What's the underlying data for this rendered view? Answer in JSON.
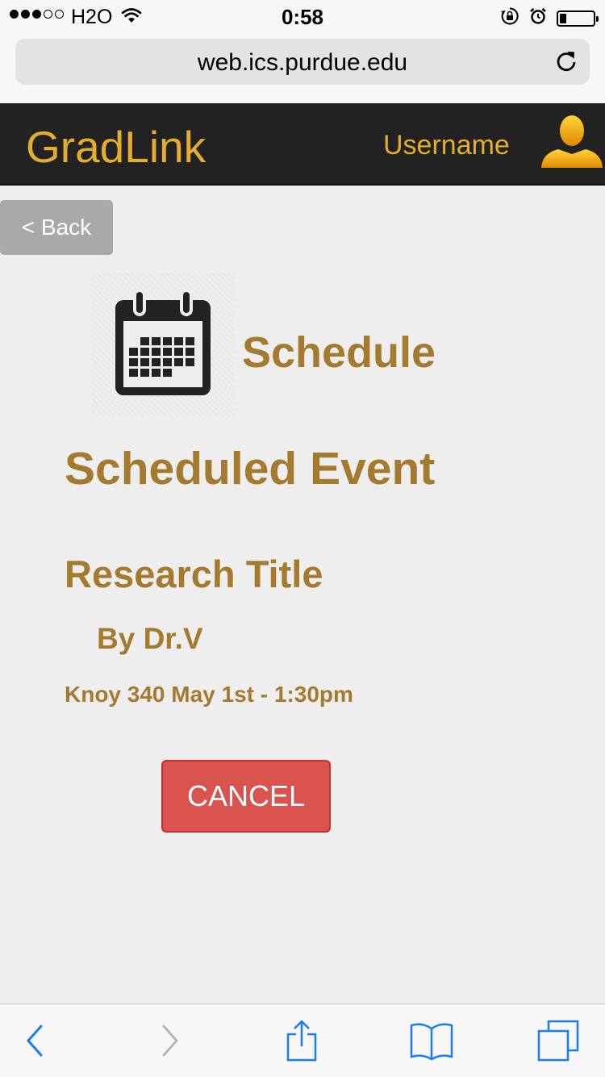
{
  "status_bar": {
    "carrier": "H2O",
    "time": "0:58",
    "signal_bars_filled": 3,
    "signal_bars_total": 5,
    "battery_level": 0.2,
    "icons": [
      "wifi-icon",
      "rotation-lock-icon",
      "alarm-icon",
      "battery-icon"
    ]
  },
  "browser": {
    "url": "web.ics.purdue.edu",
    "reload_icon": "reload-icon"
  },
  "header": {
    "brand": "GradLink",
    "username": "Username",
    "avatar_icon": "user-avatar-icon"
  },
  "nav": {
    "back_label": "< Back"
  },
  "main": {
    "section_icon": "calendar-icon",
    "section_title": "Schedule",
    "heading": "Scheduled Event",
    "event": {
      "title": "Research Title",
      "byline": "By Dr.V",
      "details": "Knoy 340 May 1st - 1:30pm"
    },
    "cancel_label": "CANCEL"
  },
  "toolbar": {
    "items": [
      "back-arrow-icon",
      "forward-arrow-icon",
      "share-icon",
      "bookmarks-icon",
      "tabs-icon"
    ]
  },
  "colors": {
    "accent": "#e4ad2b",
    "heading_text": "#a47a2f",
    "header_bg": "#222222",
    "cancel_bg": "#d9534f",
    "ios_blue": "#1a7cf5"
  }
}
